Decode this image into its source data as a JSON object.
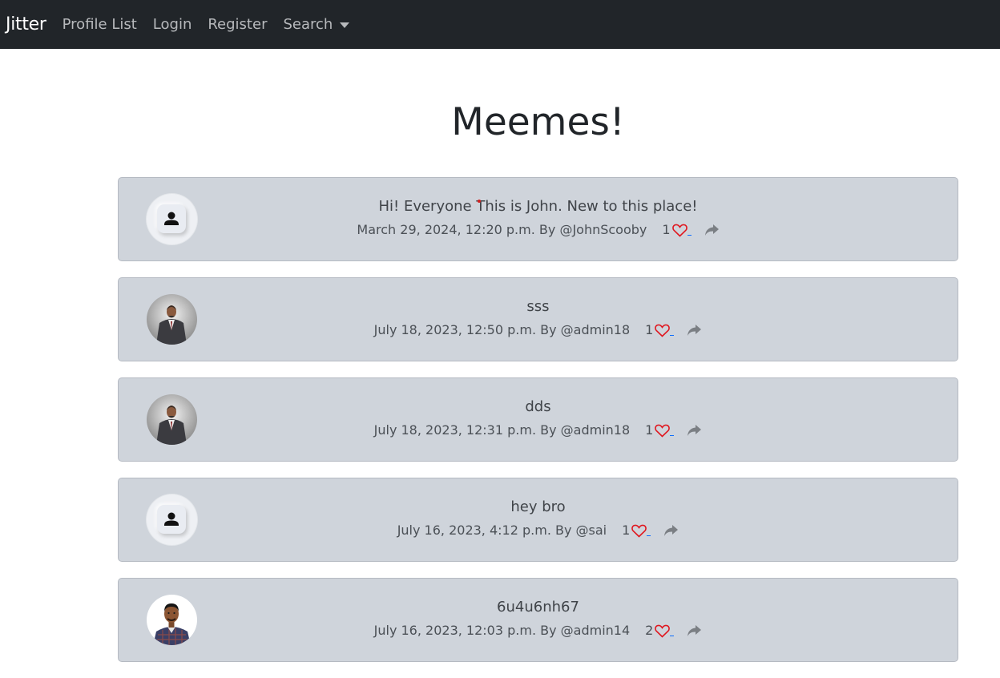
{
  "navbar": {
    "brand": "Jitter",
    "links": [
      "Profile List",
      "Login",
      "Register"
    ],
    "search_label": "Search"
  },
  "page": {
    "title": "Meemes!"
  },
  "posts": [
    {
      "text": "Hi! Everyone This is John. New to this place!",
      "date": "March 29, 2024, 12:20 p.m.",
      "by": "By @JohnScooby",
      "likes": "1",
      "avatar": "default-user-icon"
    },
    {
      "text": "sss",
      "date": "July 18, 2023, 12:50 p.m.",
      "by": "By @admin18",
      "likes": "1",
      "avatar": "man-in-suit-photo"
    },
    {
      "text": "dds",
      "date": "July 18, 2023, 12:31 p.m.",
      "by": "By @admin18",
      "likes": "1",
      "avatar": "man-in-suit-photo"
    },
    {
      "text": "hey bro",
      "date": "July 16, 2023, 4:12 p.m.",
      "by": "By @sai",
      "likes": "1",
      "avatar": "default-user-icon"
    },
    {
      "text": "6u4u6nh67",
      "date": "July 16, 2023, 12:03 p.m.",
      "by": "By @admin14",
      "likes": "2",
      "avatar": "young-man-photo"
    }
  ],
  "colors": {
    "navbar_bg": "#212529",
    "card_bg": "#cfd4db",
    "heart": "#e0161e",
    "share": "#7b7f84"
  }
}
